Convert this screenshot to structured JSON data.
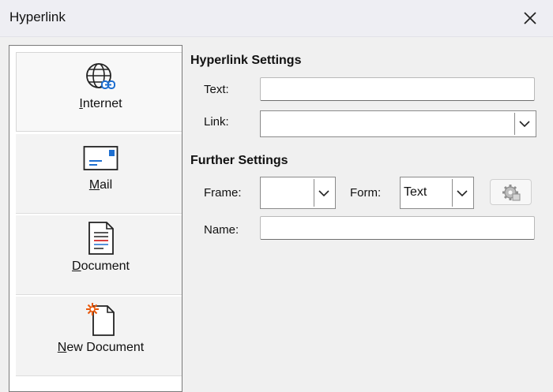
{
  "window": {
    "title": "Hyperlink"
  },
  "sidebar": {
    "items": [
      {
        "label_first": "I",
        "label_rest": "nternet",
        "icon": "globe-link-icon",
        "selected": true
      },
      {
        "label_first": "M",
        "label_rest": "ail",
        "icon": "mail-icon"
      },
      {
        "label_first": "D",
        "label_rest": "ocument",
        "icon": "document-icon"
      },
      {
        "label_first": "N",
        "label_rest": "ew Document",
        "icon": "new-document-icon"
      }
    ]
  },
  "hyperlink_settings": {
    "title": "Hyperlink Settings",
    "text_label": "Text:",
    "text_value": "",
    "link_label": "Link:",
    "link_value": ""
  },
  "further_settings": {
    "title": "Further Settings",
    "frame_label": "Frame:",
    "frame_value": "",
    "form_label": "Form:",
    "form_value": "Text",
    "name_label": "Name:",
    "name_value": ""
  },
  "colors": {
    "accent": "#1e6fd0",
    "new_doc_star": "#e8590c"
  }
}
